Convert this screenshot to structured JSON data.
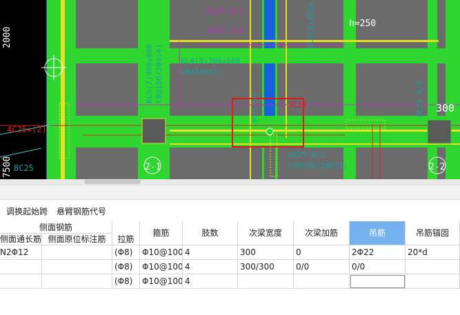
{
  "drawing": {
    "dims": {
      "left_top": "2000",
      "left_bottom": "7500"
    },
    "labels": {
      "beam_kl5": "KL5(7)400x800",
      "beam_kl5_b": "C8@100/200(4)",
      "beam_kl4": "KL4(8)300x600",
      "beam_kl4_b": "C8@100(2)",
      "height": "h=250",
      "rebar_left": "4C25+(2)",
      "rebar_left2": "8C25",
      "rebar_center": "8C25 6/2",
      "rebar_center2": "2C22",
      "rebar_right": "8C25 4/4",
      "beam_bottom": "8C25 8/2",
      "beam_bottom2": "C8@100/200(2)",
      "top_note": "4C25 2/2",
      "top_note2": "4C25 2/2",
      "top_right": "KL3(9)400x",
      "right_dim": "300",
      "section_a": "2-1",
      "section_b": "2-2"
    }
  },
  "toolbar": {
    "adjust_start_span": "调换起始跨",
    "cantilever_code": "悬臂钢筋代号"
  },
  "table": {
    "group_header": "侧面钢筋",
    "headers": {
      "side_through": "侧面通长筋",
      "side_original": "侧面原位标注筋",
      "tie": "拉筋",
      "stirrup": "箍筋",
      "legs": "肢数",
      "sec_width": "次梁宽度",
      "sec_add": "次梁加筋",
      "hanger": "吊筋",
      "hanger_anchor": "吊筋锚固"
    },
    "rows": [
      {
        "side_through": "N2Φ12",
        "side_original": "",
        "tie": "(Φ8)",
        "stirrup": "Φ10@100",
        "legs": "4",
        "sec_width": "300",
        "sec_add": "0",
        "hanger": "2Φ22",
        "hanger_anchor": "20*d"
      },
      {
        "side_through": "",
        "side_original": "",
        "tie": "(Φ8)",
        "stirrup": "Φ10@100",
        "legs": "4",
        "sec_width": "300/300",
        "sec_add": "0/0",
        "hanger": "0/0",
        "hanger_anchor": ""
      },
      {
        "side_through": "",
        "side_original": "",
        "tie": "(Φ8)",
        "stirrup": "Φ10@100",
        "legs": "4",
        "sec_width": "",
        "sec_add": "",
        "hanger": "",
        "hanger_anchor": ""
      }
    ]
  }
}
